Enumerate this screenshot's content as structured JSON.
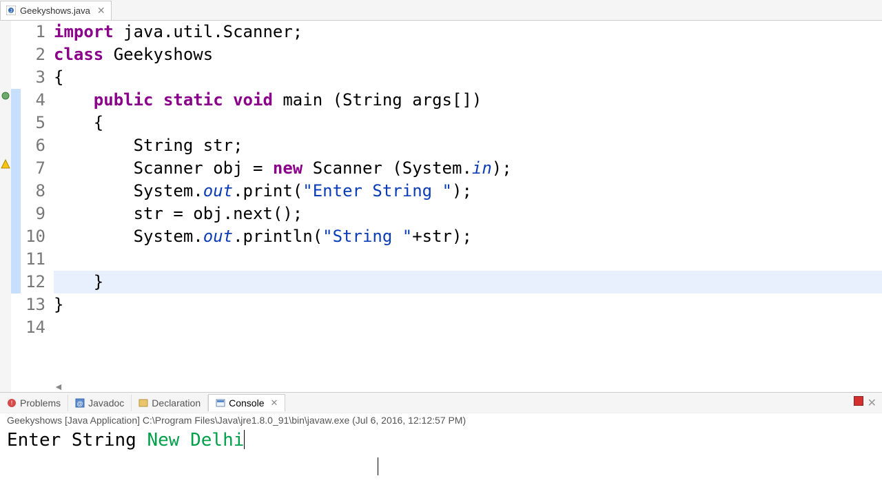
{
  "editor_tab": {
    "filename": "Geekyshows.java"
  },
  "code": {
    "lines": [
      {
        "n": "1",
        "tokens": [
          {
            "t": "import",
            "c": "kw"
          },
          {
            "t": " java.util.Scanner;",
            "c": "plain"
          }
        ]
      },
      {
        "n": "2",
        "tokens": [
          {
            "t": "class",
            "c": "kw"
          },
          {
            "t": " Geekyshows",
            "c": "plain"
          }
        ]
      },
      {
        "n": "3",
        "tokens": [
          {
            "t": "{",
            "c": "plain"
          }
        ]
      },
      {
        "n": "4",
        "tokens": [
          {
            "t": "    ",
            "c": "plain"
          },
          {
            "t": "public",
            "c": "kw"
          },
          {
            "t": " ",
            "c": "plain"
          },
          {
            "t": "static",
            "c": "kw"
          },
          {
            "t": " ",
            "c": "plain"
          },
          {
            "t": "void",
            "c": "kw"
          },
          {
            "t": " main (String args[])",
            "c": "plain"
          }
        ]
      },
      {
        "n": "5",
        "tokens": [
          {
            "t": "    {",
            "c": "plain"
          }
        ]
      },
      {
        "n": "6",
        "tokens": [
          {
            "t": "        String str;",
            "c": "plain"
          }
        ]
      },
      {
        "n": "7",
        "tokens": [
          {
            "t": "        Scanner obj = ",
            "c": "plain"
          },
          {
            "t": "new",
            "c": "kw"
          },
          {
            "t": " Scanner (System.",
            "c": "plain"
          },
          {
            "t": "in",
            "c": "fld"
          },
          {
            "t": ");",
            "c": "plain"
          }
        ]
      },
      {
        "n": "8",
        "tokens": [
          {
            "t": "        System.",
            "c": "plain"
          },
          {
            "t": "out",
            "c": "fld"
          },
          {
            "t": ".print(",
            "c": "plain"
          },
          {
            "t": "\"Enter String \"",
            "c": "str"
          },
          {
            "t": ");",
            "c": "plain"
          }
        ]
      },
      {
        "n": "9",
        "tokens": [
          {
            "t": "        str = obj.next();",
            "c": "plain"
          }
        ]
      },
      {
        "n": "10",
        "tokens": [
          {
            "t": "        System.",
            "c": "plain"
          },
          {
            "t": "out",
            "c": "fld"
          },
          {
            "t": ".println(",
            "c": "plain"
          },
          {
            "t": "\"String \"",
            "c": "str"
          },
          {
            "t": "+str);",
            "c": "plain"
          }
        ]
      },
      {
        "n": "11",
        "tokens": []
      },
      {
        "n": "12",
        "tokens": [
          {
            "t": "    }",
            "c": "plain"
          }
        ],
        "hl": true
      },
      {
        "n": "13",
        "tokens": [
          {
            "t": "}",
            "c": "plain"
          }
        ]
      },
      {
        "n": "14",
        "tokens": []
      }
    ]
  },
  "panels": {
    "problems": "Problems",
    "javadoc": "Javadoc",
    "declaration": "Declaration",
    "console": "Console"
  },
  "console": {
    "info": "Geekyshows [Java Application] C:\\Program Files\\Java\\jre1.8.0_91\\bin\\javaw.exe (Jul 6, 2016, 12:12:57 PM)",
    "prompt": "Enter String ",
    "input": "New Delhi"
  }
}
